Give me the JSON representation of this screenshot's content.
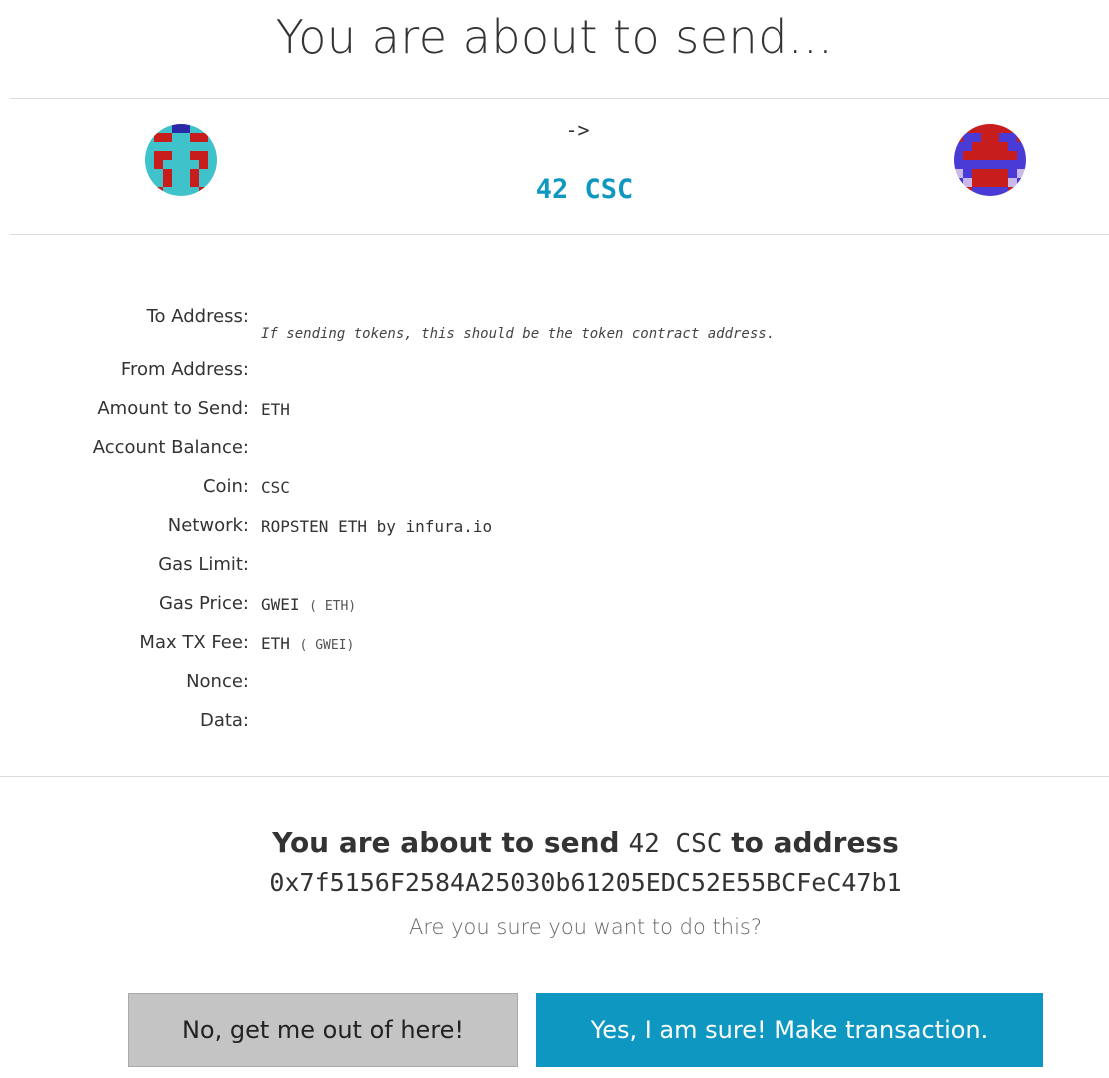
{
  "header": {
    "title": "You are about to send..."
  },
  "transfer": {
    "arrow": "->",
    "amount": "42 CSC"
  },
  "details": {
    "to_address": {
      "label": "To Address:",
      "hint": "If sending tokens, this should be the token contract address."
    },
    "from_address": {
      "label": "From Address:",
      "value": ""
    },
    "amount_to_send": {
      "label": "Amount to Send:",
      "value": "ETH"
    },
    "account_balance": {
      "label": "Account Balance:",
      "value": ""
    },
    "coin": {
      "label": "Coin:",
      "value": "CSC"
    },
    "network": {
      "label": "Network:",
      "value": "ROPSTEN ETH by infura.io"
    },
    "gas_limit": {
      "label": "Gas Limit:",
      "value": ""
    },
    "gas_price": {
      "label": "Gas Price:",
      "value": "GWEI",
      "sub": "( ETH)"
    },
    "max_tx_fee": {
      "label": "Max TX Fee:",
      "value": "ETH",
      "sub": "( GWEI)"
    },
    "nonce": {
      "label": "Nonce:",
      "value": ""
    },
    "data": {
      "label": "Data:",
      "value": ""
    }
  },
  "confirmation": {
    "prefix": "You are about to send",
    "amount": "42 CSC",
    "suffix": "to address",
    "address": "0x7f5156F2584A25030b61205EDC52E55BCFeC47b1",
    "question": "Are you sure you want to do this?"
  },
  "buttons": {
    "cancel_label": "No, get me out of here!",
    "confirm_label": "Yes, I am sure! Make transaction."
  },
  "colors": {
    "accent": "#0e97c0",
    "cancel_bg": "#c4c4c4",
    "identicon_from": [
      "#c71d1d",
      "#3fc2c9",
      "#2a2aa8"
    ],
    "identicon_to": [
      "#c71d1d",
      "#4a3ad6",
      "#c9b8e8"
    ]
  },
  "icons": {
    "from": "from-address-identicon",
    "to": "to-address-identicon"
  }
}
